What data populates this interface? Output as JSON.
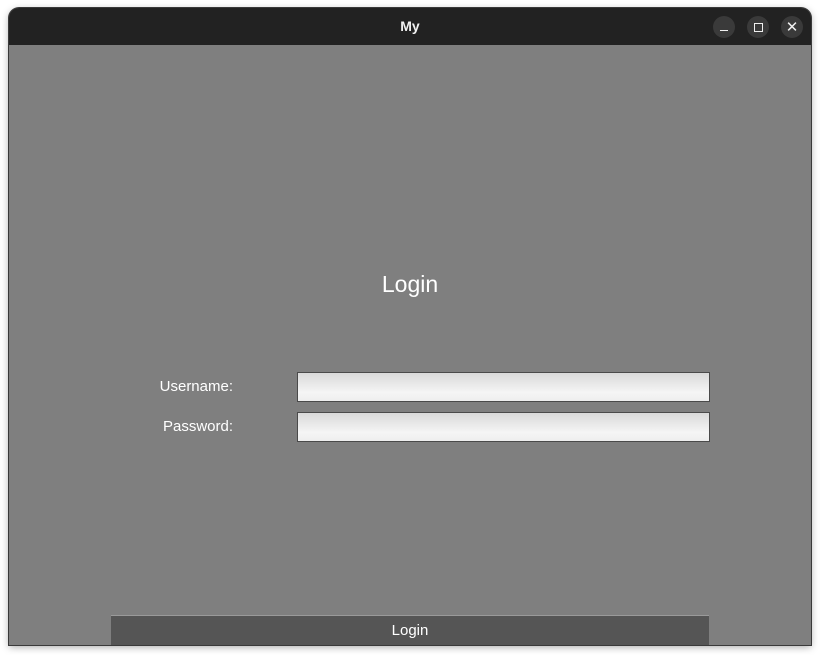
{
  "window": {
    "title": "My",
    "controls": {
      "minimize_icon": "minimize-icon",
      "maximize_icon": "maximize-icon",
      "close_icon": "close-icon"
    }
  },
  "login_form": {
    "heading": "Login",
    "username_label": "Username:",
    "username_value": "",
    "password_label": "Password:",
    "password_value": "",
    "submit_label": "Login"
  },
  "colors": {
    "titlebar": "#222222",
    "background": "#7f7f7f",
    "button": "#555555",
    "text": "#ffffff"
  }
}
